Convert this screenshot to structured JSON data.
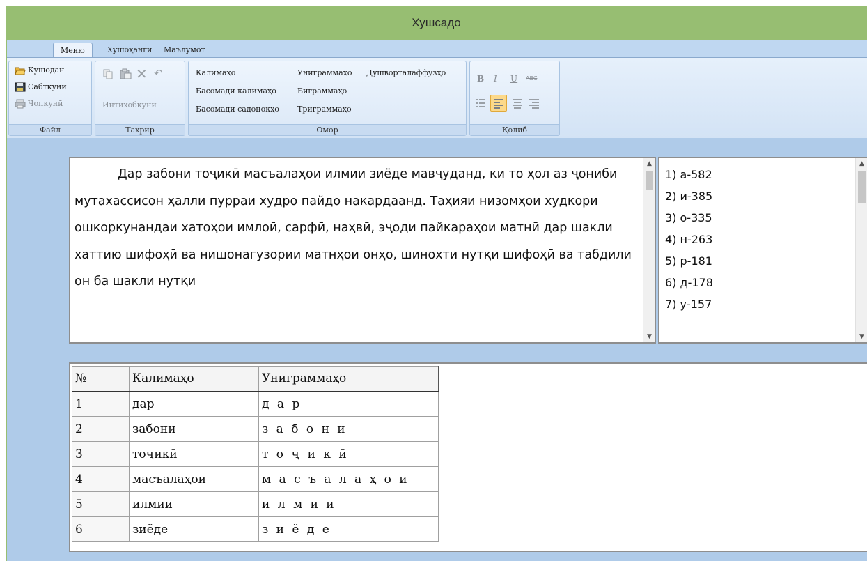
{
  "window": {
    "title": "Хушсадо"
  },
  "tabs": [
    {
      "label": "Меню",
      "active": true
    },
    {
      "label": "Хушоҳангӣ",
      "active": false
    },
    {
      "label": "Маълумот",
      "active": false
    }
  ],
  "ribbon": {
    "file": {
      "label": "Файл",
      "open": "Кушодан",
      "save": "Сабткунӣ",
      "print": "Чопкунӣ"
    },
    "edit": {
      "label": "Тахрир",
      "select": "Интихобкунӣ"
    },
    "stats": {
      "label": "Омор",
      "words": "Калимаҳо",
      "word_frequency": "Басомади калимаҳо",
      "vowel_frequency": "Басомади садонокҳо",
      "unigrams": "Униграммаҳо",
      "bigrams": "Биграммаҳо",
      "trigrams": "Триграммаҳо",
      "hard_words": "Душворталаффузҳо"
    },
    "format": {
      "label": "Қолиб",
      "bold": "B",
      "italic": "I",
      "underline": "U",
      "strike": "ABC"
    }
  },
  "text_pane": {
    "content": "Дар забони тоҷикӣ масъалаҳои илмии зиёде мавҷуданд, ки то ҳол аз ҷониби мутахассисон ҳалли пурраи худро пайдо накардаанд. Таҳияи низомҳои худкори ошкоркунандаи хатоҳои имлоӣ, сарфӣ, наҳвӣ, эҷоди пайкараҳои матнӣ дар шакли хаттию шифоҳӣ ва нишонагузории матнҳои онҳо, шинохти нутқи шифоҳӣ ва табдили он ба шакли нутқи"
  },
  "frequency_list": [
    "1) а-582",
    "2) и-385",
    "3) о-335",
    "4) н-263",
    "5) р-181",
    "6) д-178",
    "7) у-157"
  ],
  "grid": {
    "headers": [
      "№",
      "Калимаҳо",
      "Униграммаҳо"
    ],
    "rows": [
      [
        "1",
        "дар",
        "д а р"
      ],
      [
        "2",
        "забони",
        "з а б о н и"
      ],
      [
        "3",
        "тоҷикӣ",
        "т о ҷ и к ӣ"
      ],
      [
        "4",
        "масъалаҳои",
        "м а с ъ а л а ҳ о и"
      ],
      [
        "5",
        "илмии",
        "и л м и и"
      ],
      [
        "6",
        "зиёде",
        "з и ё д е"
      ]
    ]
  },
  "colors": {
    "titlebar": "#97be72",
    "workspace": "#afcbe9",
    "ribbon": "#dbe8f7"
  }
}
